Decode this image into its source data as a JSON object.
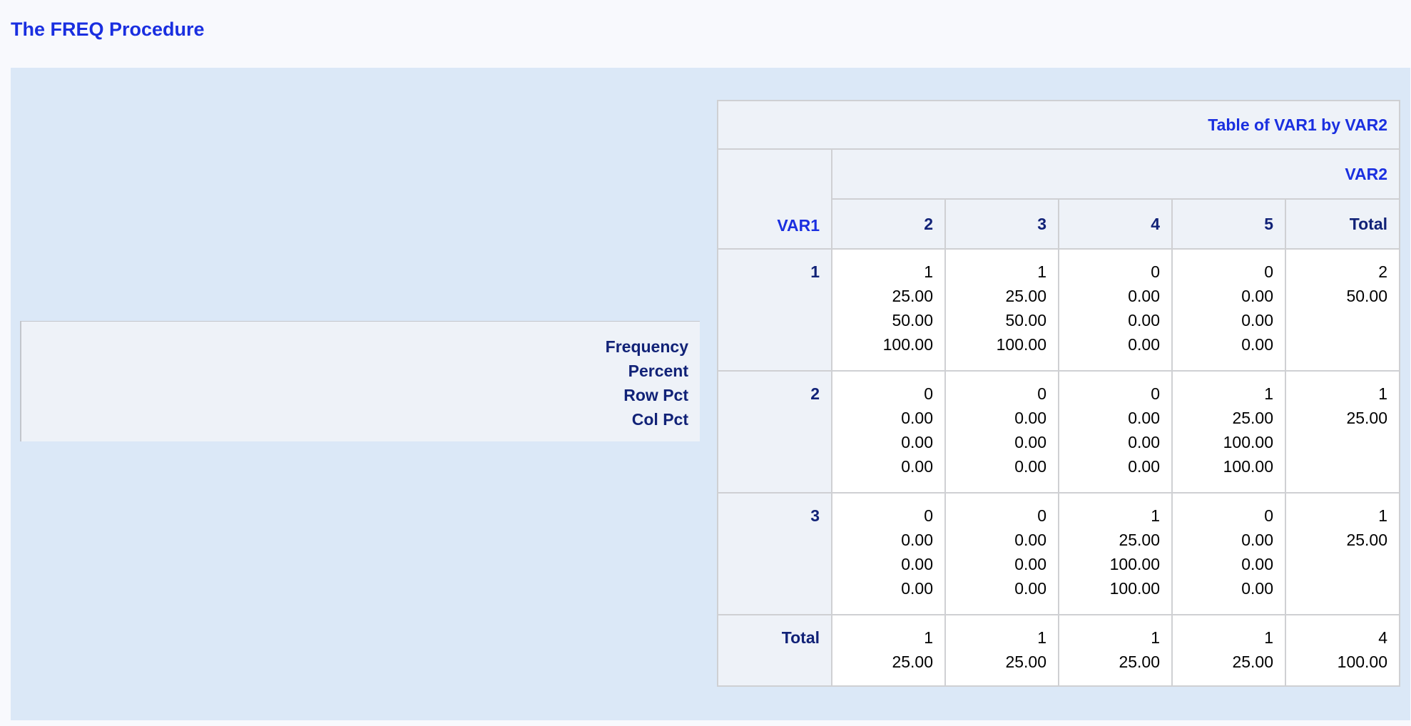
{
  "page_title": "The FREQ Procedure",
  "legend": [
    "Frequency",
    "Percent",
    "Row Pct",
    "Col Pct"
  ],
  "table": {
    "title": "Table of VAR1 by VAR2",
    "col_var": "VAR2",
    "row_var": "VAR1",
    "columns": [
      "2",
      "3",
      "4",
      "5",
      "Total"
    ],
    "rows": [
      {
        "label": "1",
        "cells": [
          [
            "1",
            "25.00",
            "50.00",
            "100.00"
          ],
          [
            "1",
            "25.00",
            "50.00",
            "100.00"
          ],
          [
            "0",
            "0.00",
            "0.00",
            "0.00"
          ],
          [
            "0",
            "0.00",
            "0.00",
            "0.00"
          ],
          [
            "2",
            "50.00"
          ]
        ]
      },
      {
        "label": "2",
        "cells": [
          [
            "0",
            "0.00",
            "0.00",
            "0.00"
          ],
          [
            "0",
            "0.00",
            "0.00",
            "0.00"
          ],
          [
            "0",
            "0.00",
            "0.00",
            "0.00"
          ],
          [
            "1",
            "25.00",
            "100.00",
            "100.00"
          ],
          [
            "1",
            "25.00"
          ]
        ]
      },
      {
        "label": "3",
        "cells": [
          [
            "0",
            "0.00",
            "0.00",
            "0.00"
          ],
          [
            "0",
            "0.00",
            "0.00",
            "0.00"
          ],
          [
            "1",
            "25.00",
            "100.00",
            "100.00"
          ],
          [
            "0",
            "0.00",
            "0.00",
            "0.00"
          ],
          [
            "1",
            "25.00"
          ]
        ]
      }
    ],
    "total_row": {
      "label": "Total",
      "cells": [
        [
          "1",
          "25.00"
        ],
        [
          "1",
          "25.00"
        ],
        [
          "1",
          "25.00"
        ],
        [
          "1",
          "25.00"
        ],
        [
          "4",
          "100.00"
        ]
      ]
    }
  },
  "colors": {
    "title_blue": "#1a2fe0",
    "header_navy": "#112277",
    "panel_bg": "#dbe8f7",
    "header_bg": "#eef2f8"
  }
}
